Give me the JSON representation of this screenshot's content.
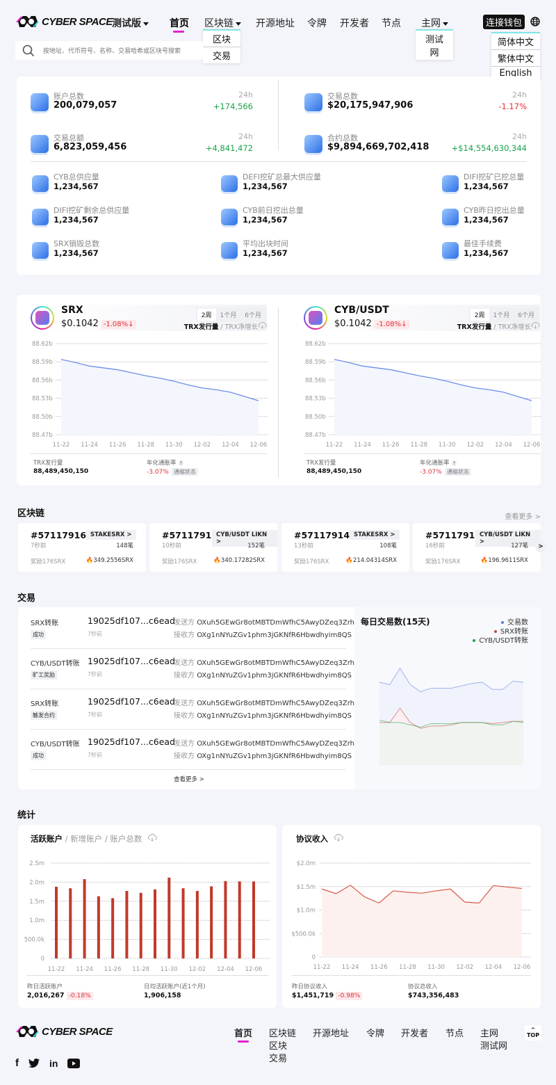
{
  "header": {
    "brand": "CYBER SPACE",
    "version_select": "测试版",
    "nav": [
      {
        "label": "首页",
        "active": true
      },
      {
        "label": "区块链",
        "dropdown": true
      },
      {
        "label": "开源地址"
      },
      {
        "label": "令牌"
      },
      {
        "label": "开发者"
      },
      {
        "label": "节点"
      },
      {
        "label": "主网",
        "dropdown": true
      }
    ],
    "blockchain_menu": [
      "区块",
      "交易"
    ],
    "network_menu": [
      "测试网"
    ],
    "connect_wallet": "连接钱包",
    "language_menu": [
      "简体中文",
      "繁体中文",
      "English"
    ],
    "search_placeholder": "按地址、代币符号、名称、交易哈希或区块号搜索"
  },
  "overview": {
    "period_label": "24h",
    "top": [
      {
        "label": "账户总数",
        "value": "200,079,057",
        "change": "+174,566",
        "trend": "up"
      },
      {
        "label": "交易总额",
        "value": "6,823,059,456",
        "change": "+4,841,472",
        "trend": "up"
      },
      {
        "label": "交易总数",
        "value": "$20,175,947,906",
        "change": "-1.17%",
        "trend": "down"
      },
      {
        "label": "合约总数",
        "value": "$9,894,669,702,418",
        "change": "+$14,554,630,344",
        "trend": "up"
      }
    ],
    "grid": [
      {
        "label": "CYB总供应量",
        "value": "1,234,567"
      },
      {
        "label": "DEFI挖矿总最大供应量",
        "value": "1,234,567"
      },
      {
        "label": "DIFI挖矿已挖总量",
        "value": "1,234,567"
      },
      {
        "label": "DIFI挖矿剩余总供应量",
        "value": "1,234,567"
      },
      {
        "label": "CYB前日挖出总量",
        "value": "1,234,567"
      },
      {
        "label": "CYB昨日挖出总量",
        "value": "1,234,567"
      },
      {
        "label": "SRX销毁总数",
        "value": "1,234,567"
      },
      {
        "label": "平均出块时间",
        "value": "1,234,567"
      },
      {
        "label": "最佳手续费",
        "value": "1,234,567"
      }
    ]
  },
  "tokens": [
    {
      "name": "SRX",
      "price": "$0.1042",
      "change": "-1.08%↓",
      "tabs": [
        "2周",
        "1个月",
        "6个月"
      ],
      "active_tab": "2周",
      "metric_active": "TRX发行量",
      "metric_sep": " / ",
      "metric_other": "TRX净增长",
      "supply_label": "TRX发行量",
      "supply_value": "88,489,450,150",
      "inflation_label": "年化通胀率",
      "inflation_value": "-3.07%",
      "inflation_status": "通缩状态"
    },
    {
      "name": "CYB/USDT",
      "price": "$0.1042",
      "change": "-1.08%↓",
      "tabs": [
        "2周",
        "1个月",
        "6个月"
      ],
      "active_tab": "2周",
      "metric_active": "TRX发行量",
      "metric_sep": " / ",
      "metric_other": "TRX净增长",
      "supply_label": "TRX发行量",
      "supply_value": "88,489,450,150",
      "inflation_label": "年化通胀率",
      "inflation_value": "-3.07%",
      "inflation_status": "通缩状态"
    }
  ],
  "blocks": {
    "title": "区块链",
    "more": "查看更多 >",
    "items": [
      {
        "number": "#57117916",
        "tag": "STAKESRX >",
        "time": "7秒前",
        "count": "148笔",
        "reward": "奖励176SRX",
        "burn": "349.2556SRX"
      },
      {
        "number": "#57117915",
        "tag": "CYB/USDT LIKN >",
        "time": "10秒前",
        "count": "152笔",
        "reward": "奖励176SRX",
        "burn": "340.17282SRX"
      },
      {
        "number": "#57117914",
        "tag": "STAKESRX >",
        "time": "13秒前",
        "count": "108笔",
        "reward": "奖励176SRX",
        "burn": "214.04314SRX"
      },
      {
        "number": "#57117913",
        "tag": "CYB/USDT LIKN >",
        "time": "16秒前",
        "count": "127笔",
        "reward": "奖励176SRX",
        "burn": "196.9611SRX"
      }
    ]
  },
  "transactions": {
    "title": "交易",
    "sender_label": "发送方",
    "receiver_label": "接收方",
    "more": "查看更多 >",
    "items": [
      {
        "type": "SRX转账",
        "status": "成功",
        "hash": "19025df107...c6ead",
        "time": "7秒前",
        "from": "OXuh5GEwGr8otMBTDmWfhC5AwyDZeq3Zrh",
        "to": "OXg1nNYuZGv1phm3jGKNfR6Hbwdhyim8QS"
      },
      {
        "type": "CYB/USDT转账",
        "status": "旷工奖励",
        "hash": "19025df107...c6ead",
        "time": "7秒前",
        "from": "OXuh5GEwGr8otMBTDmWfhC5AwyDZeq3Zrh",
        "to": "OXg1nNYuZGv1phm3jGKNfR6Hbwdhyim8QS"
      },
      {
        "type": "SRX转账",
        "status": "触发合约",
        "hash": "19025df107...c6ead",
        "time": "7秒前",
        "from": "OXuh5GEwGr8otMBTDmWfhC5AwyDZeq3Zrh",
        "to": "OXg1nNYuZGv1phm3jGKNfR6Hbwdhyim8QS"
      },
      {
        "type": "CYB/USDT转账",
        "status": "成功",
        "hash": "19025df107...c6ead",
        "time": "7秒前",
        "from": "OXuh5GEwGr8otMBTDmWfhC5AwyDZeq3Zrh",
        "to": "OXg1nNYuZGv1phm3jGKNfR6Hbwdhyim8QS"
      }
    ]
  },
  "stats": {
    "title": "统计",
    "accounts": {
      "tab_active": "活跃账户",
      "tab_2": "新增账户",
      "tab_3": "账户总数",
      "sep": " / ",
      "yesterday_label": "昨日活跃账户",
      "yesterday_value": "2,016,267",
      "yesterday_change": "-0.18%",
      "avg_label": "日均活跃账户(近1个月)",
      "avg_value": "1,906,158"
    },
    "revenue": {
      "title": "协议收入",
      "yesterday_label": "昨日协议收入",
      "yesterday_value": "$1,451,719",
      "yesterday_change": "-0.98%",
      "total_label": "协议总收入",
      "total_value": "$743,356,483"
    }
  },
  "footer": {
    "brand": "CYBER SPACE",
    "nav": [
      "首页",
      "区块链",
      "开源地址",
      "令牌",
      "开发者",
      "节点",
      "主网"
    ],
    "blockchain_sub": [
      "区块",
      "交易"
    ],
    "network_sub": [
      "测试网"
    ],
    "top": "TOP",
    "social": [
      "facebook",
      "twitter",
      "linkedin",
      "youtube"
    ]
  },
  "chart_data": [
    {
      "type": "line",
      "title": "SRX TRX发行量",
      "x": [
        "11-22",
        "11-23",
        "11-24",
        "11-25",
        "11-26",
        "11-27",
        "11-28",
        "11-29",
        "11-30",
        "12-01",
        "12-02",
        "12-03",
        "12-04",
        "12-05",
        "12-06"
      ],
      "series": [
        {
          "name": "TRX发行量",
          "values": [
            88.594,
            88.589,
            88.583,
            88.58,
            88.577,
            88.572,
            88.567,
            88.563,
            88.558,
            88.552,
            88.547,
            88.544,
            88.54,
            88.533,
            88.526
          ]
        }
      ],
      "yticks": [
        "88.47b",
        "88.50b",
        "88.53b",
        "88.56b",
        "88.59b",
        "88.62b"
      ],
      "ylim": [
        88.47,
        88.62
      ],
      "xticks": [
        "11-22",
        "11-24",
        "11-26",
        "11-28",
        "11-30",
        "12-02",
        "12-04",
        "12-06"
      ],
      "color": "#6d8ee8"
    },
    {
      "type": "line",
      "title": "CYB/USDT TRX发行量",
      "x": [
        "11-22",
        "11-23",
        "11-24",
        "11-25",
        "11-26",
        "11-27",
        "11-28",
        "11-29",
        "11-30",
        "12-01",
        "12-02",
        "12-03",
        "12-04",
        "12-05",
        "12-06"
      ],
      "series": [
        {
          "name": "TRX发行量",
          "values": [
            88.594,
            88.589,
            88.583,
            88.58,
            88.577,
            88.572,
            88.567,
            88.563,
            88.558,
            88.552,
            88.547,
            88.544,
            88.54,
            88.533,
            88.526
          ]
        }
      ],
      "yticks": [
        "88.47b",
        "88.50b",
        "88.53b",
        "88.56b",
        "88.59b",
        "88.62b"
      ],
      "ylim": [
        88.47,
        88.62
      ],
      "xticks": [
        "11-22",
        "11-24",
        "11-26",
        "11-28",
        "11-30",
        "12-02",
        "12-04",
        "12-06"
      ],
      "color": "#6d8ee8"
    },
    {
      "type": "area",
      "title": "每日交易数(15天)",
      "legend": "top-right",
      "series": [
        {
          "name": "交易数",
          "color": "#5b7fe0",
          "values": [
            70,
            68,
            82,
            68,
            62,
            65,
            65,
            65,
            67,
            69,
            70,
            64,
            64,
            71,
            70
          ]
        },
        {
          "name": "SRX转账",
          "color": "#c9453d",
          "values": [
            36,
            36,
            48,
            36,
            31,
            33,
            33,
            34,
            36,
            36,
            36,
            35,
            36,
            37,
            37
          ]
        },
        {
          "name": "CYB/USDT转账",
          "color": "#1aa34a",
          "values": [
            38,
            36,
            36,
            34,
            32,
            35,
            35,
            35,
            36,
            36,
            36,
            34,
            34,
            37,
            36
          ]
        }
      ],
      "ylim": [
        0,
        100
      ]
    },
    {
      "type": "bar",
      "title": "活跃账户",
      "x": [
        "11-22",
        "11-23",
        "11-24",
        "11-25",
        "11-26",
        "11-27",
        "11-28",
        "11-29",
        "11-30",
        "12-01",
        "12-02",
        "12-03",
        "12-04",
        "12-05",
        "12-06"
      ],
      "values": [
        1.88,
        1.84,
        2.08,
        1.63,
        1.58,
        1.77,
        1.72,
        1.81,
        2.12,
        1.84,
        1.77,
        1.89,
        2.03,
        2.02,
        2.02
      ],
      "yticks": [
        "0",
        "500.0k",
        "1.0m",
        "1.5m",
        "2.0m",
        "2.5m"
      ],
      "ylim": [
        0,
        2.5
      ],
      "xticks": [
        "11-22",
        "11-24",
        "11-26",
        "11-28",
        "11-30",
        "12-02",
        "12-04",
        "12-06"
      ],
      "color": "#c0392b",
      "unit": "m"
    },
    {
      "type": "area",
      "title": "协议收入",
      "x": [
        "11-22",
        "11-23",
        "11-24",
        "11-25",
        "11-26",
        "11-27",
        "11-28",
        "11-29",
        "11-30",
        "12-01",
        "12-02",
        "12-03",
        "12-04",
        "12-05",
        "12-06"
      ],
      "values": [
        1.45,
        1.35,
        1.53,
        1.28,
        1.15,
        1.41,
        1.38,
        1.36,
        1.41,
        1.45,
        1.17,
        1.15,
        1.52,
        1.49,
        1.46
      ],
      "yticks": [
        "0",
        "$500.0k",
        "$1.0m",
        "$1.5m",
        "$2.0m"
      ],
      "ylim": [
        0,
        2.0
      ],
      "xticks": [
        "11-22",
        "11-24",
        "11-26",
        "11-28",
        "11-30",
        "12-02",
        "12-04",
        "12-06"
      ],
      "color": "#d45a4c",
      "unit": "$m"
    }
  ]
}
